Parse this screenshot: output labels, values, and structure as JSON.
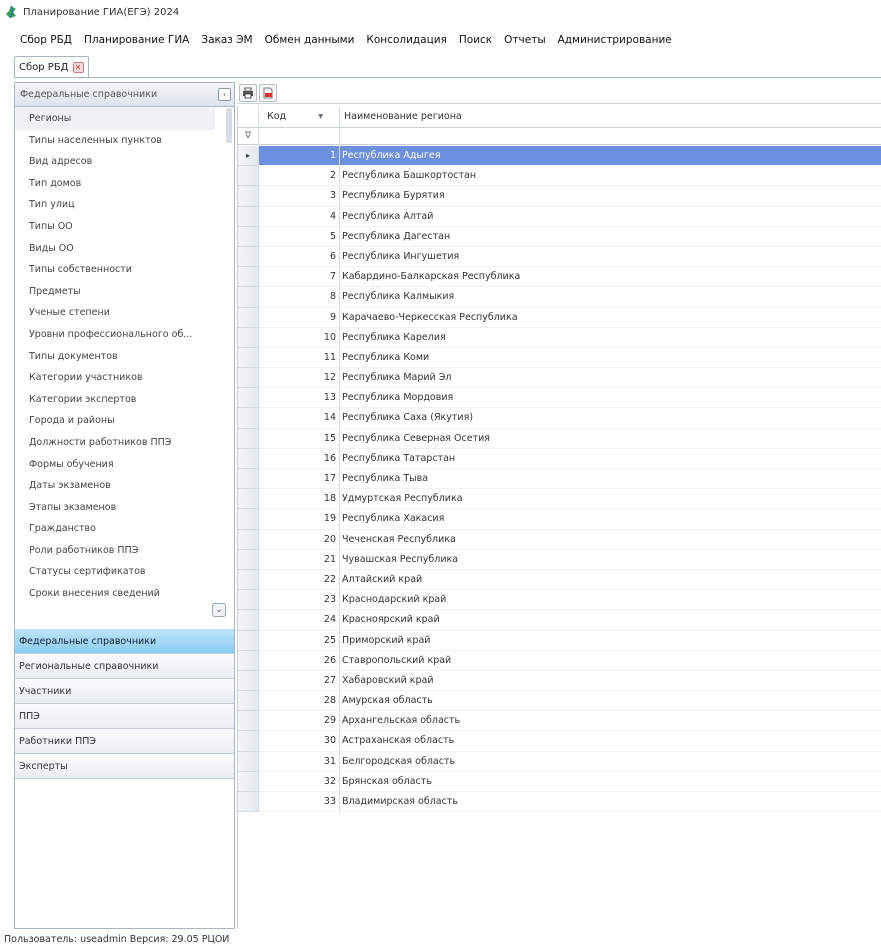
{
  "window": {
    "title": "Планирование ГИА(ЕГЭ) 2024"
  },
  "menu": [
    "Сбор РБД",
    "Планирование ГИА",
    "Заказ ЭМ",
    "Обмен данными",
    "Консолидация",
    "Поиск",
    "Отчеты",
    "Администрирование"
  ],
  "doc_tab": {
    "label": "Сбор РБД"
  },
  "nav": {
    "header": "Федеральные справочники",
    "items": [
      "Регионы",
      "Типы населенных пунктов",
      "Вид адресов",
      "Тип домов",
      "Тип улиц",
      "Типы ОО",
      "Виды ОО",
      "Типы собственности",
      "Предметы",
      "Ученые степени",
      "Уровни профессионального об...",
      "Типы документов",
      "Категории участников",
      "Категории экспертов",
      "Города и районы",
      "Должности работников ППЭ",
      "Формы обучения",
      "Даты экзаменов",
      "Этапы экзаменов",
      "Гражданство",
      "Роли работников ППЭ",
      "Статусы сертификатов",
      "Сроки внесения сведений"
    ],
    "groups": [
      "Федеральные справочники",
      "Региональные справочники",
      "Участники",
      "ППЭ",
      "Работники ППЭ",
      "Эксперты"
    ]
  },
  "grid": {
    "columns": {
      "code": "Код",
      "name": "Наименование региона"
    },
    "filter_symbol": "∇",
    "current_row_marker": "▸",
    "rows": [
      {
        "code": "1",
        "name": "Республика Адыгея"
      },
      {
        "code": "2",
        "name": "Республика Башкортостан"
      },
      {
        "code": "3",
        "name": "Республика Бурятия"
      },
      {
        "code": "4",
        "name": "Республика Алтай"
      },
      {
        "code": "5",
        "name": "Республика Дагестан"
      },
      {
        "code": "6",
        "name": "Республика Ингушетия"
      },
      {
        "code": "7",
        "name": "Кабардино-Балкарская Республика"
      },
      {
        "code": "8",
        "name": "Республика Калмыкия"
      },
      {
        "code": "9",
        "name": "Карачаево-Черкесская Республика"
      },
      {
        "code": "10",
        "name": "Республика Карелия"
      },
      {
        "code": "11",
        "name": "Республика Коми"
      },
      {
        "code": "12",
        "name": "Республика Марий Эл"
      },
      {
        "code": "13",
        "name": "Республика Мордовия"
      },
      {
        "code": "14",
        "name": "Республика Саха (Якутия)"
      },
      {
        "code": "15",
        "name": "Республика Северная Осетия"
      },
      {
        "code": "16",
        "name": "Республика Татарстан"
      },
      {
        "code": "17",
        "name": "Республика Тыва"
      },
      {
        "code": "18",
        "name": "Удмуртская Республика"
      },
      {
        "code": "19",
        "name": "Республика Хакасия"
      },
      {
        "code": "20",
        "name": "Чеченская Республика"
      },
      {
        "code": "21",
        "name": "Чувашская Республика"
      },
      {
        "code": "22",
        "name": "Алтайский край"
      },
      {
        "code": "23",
        "name": "Краснодарский край"
      },
      {
        "code": "24",
        "name": "Красноярский край"
      },
      {
        "code": "25",
        "name": "Приморский край"
      },
      {
        "code": "26",
        "name": "Ставропольский край"
      },
      {
        "code": "27",
        "name": "Хабаровский край"
      },
      {
        "code": "28",
        "name": "Амурская область"
      },
      {
        "code": "29",
        "name": "Архангельская область"
      },
      {
        "code": "30",
        "name": "Астраханская область"
      },
      {
        "code": "31",
        "name": "Белгородская область"
      },
      {
        "code": "32",
        "name": "Брянская область"
      },
      {
        "code": "33",
        "name": "Владимирская область"
      }
    ]
  },
  "status": {
    "text": "Пользователь: useadmin  Версия: 29.05  РЦОИ"
  },
  "colors": {
    "selection": "#6d8fe0",
    "active_group": "#8ccdf5"
  }
}
